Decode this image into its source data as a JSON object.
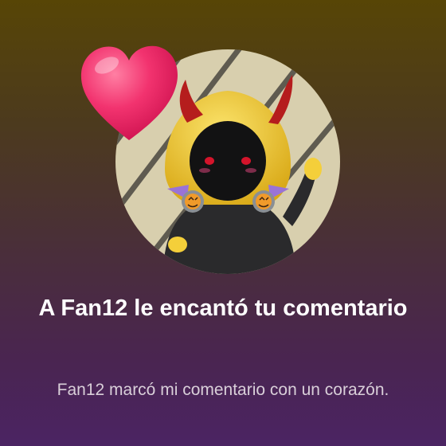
{
  "notification": {
    "title": "A Fan12 le encantó tu comentario",
    "message": "Fan12 marcó mi comentario con un corazón.",
    "avatar_icon": "devil-hood-avatar-icon",
    "badge_icon": "heart-icon"
  },
  "colors": {
    "background_top": "#574506",
    "background_bottom": "#4b2463",
    "avatar_bg": "#d8cfae",
    "heart": "#ee2a6a",
    "title_text": "#ffffff",
    "message_text": "#d9cfd9"
  }
}
